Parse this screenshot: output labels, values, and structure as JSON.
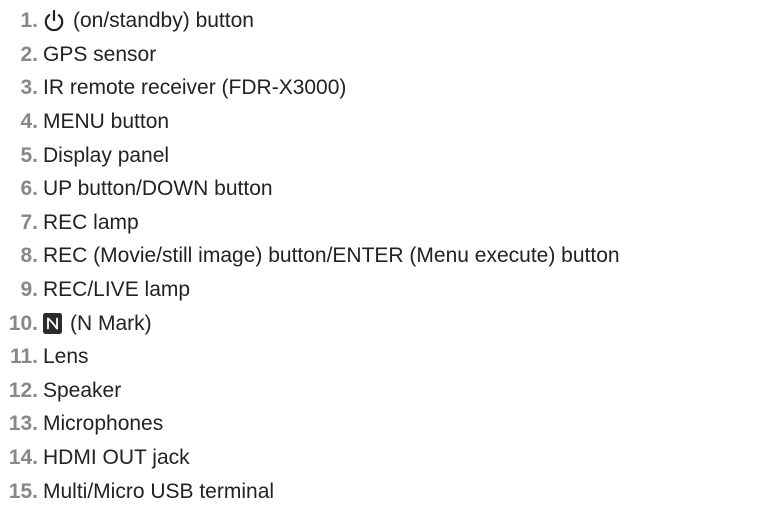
{
  "items": [
    {
      "number": "1.",
      "icon": "power-standby-icon",
      "label": "(on/standby) button"
    },
    {
      "number": "2.",
      "label": "GPS sensor"
    },
    {
      "number": "3.",
      "label": "IR remote receiver (FDR-X3000)"
    },
    {
      "number": "4.",
      "label": "MENU button"
    },
    {
      "number": "5.",
      "label": "Display panel"
    },
    {
      "number": "6.",
      "label": "UP button/DOWN button"
    },
    {
      "number": "7.",
      "label": "REC lamp"
    },
    {
      "number": "8.",
      "label": "REC (Movie/still image) button/ENTER (Menu execute) button"
    },
    {
      "number": "9.",
      "label": "REC/LIVE lamp"
    },
    {
      "number": "10.",
      "icon": "n-mark-icon",
      "label": "(N Mark)"
    },
    {
      "number": "11.",
      "label": "Lens"
    },
    {
      "number": "12.",
      "label": "Speaker"
    },
    {
      "number": "13.",
      "label": "Microphones"
    },
    {
      "number": "14.",
      "label": "HDMI OUT jack"
    },
    {
      "number": "15.",
      "label": "Multi/Micro USB terminal"
    }
  ],
  "colors": {
    "number": "#888888",
    "text": "#222222",
    "n_mark_background": "#2b2b2b"
  }
}
